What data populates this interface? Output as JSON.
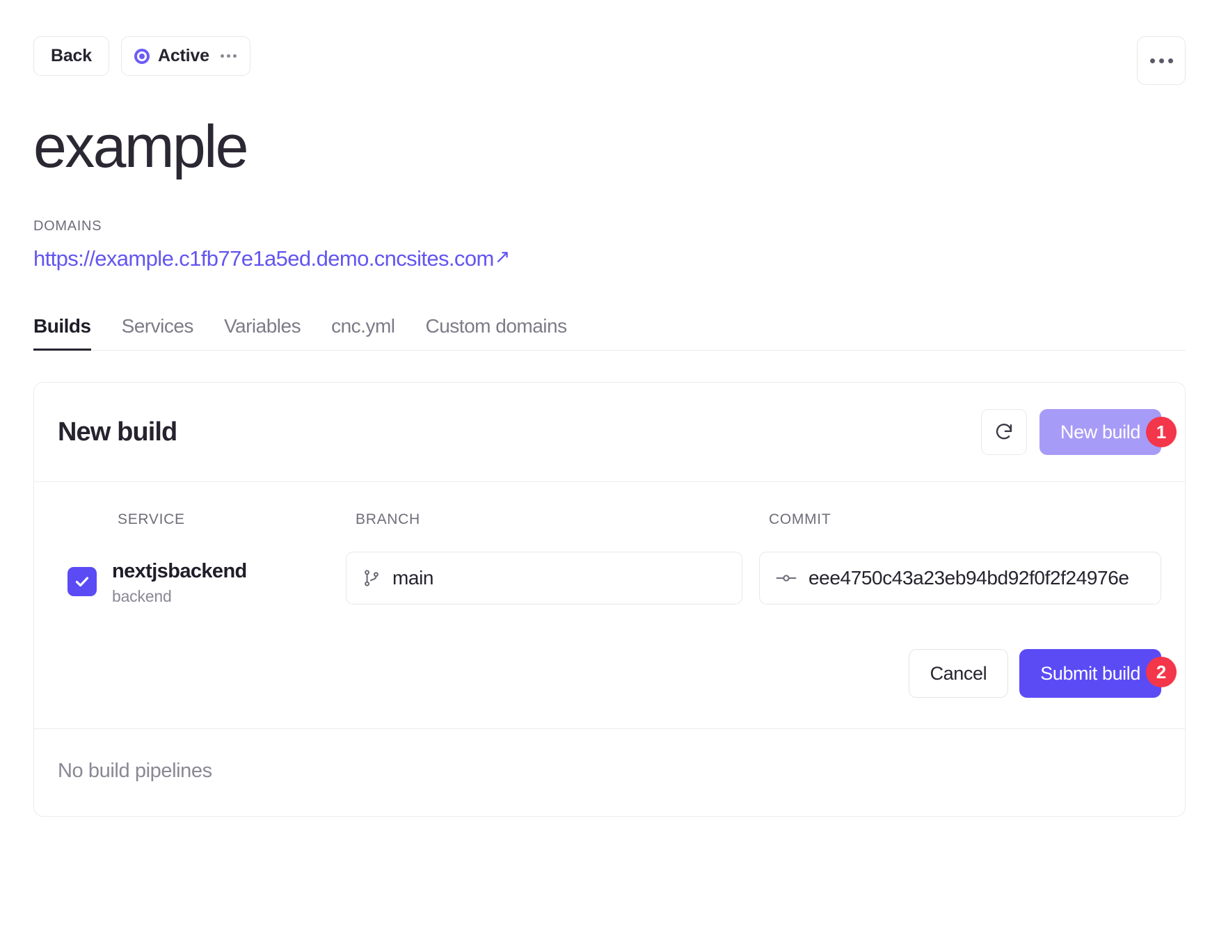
{
  "topbar": {
    "back_label": "Back",
    "status_label": "Active",
    "status_menu_icon": "ellipsis-icon",
    "overflow_menu_icon": "ellipsis-icon"
  },
  "header": {
    "title": "example",
    "domains_label": "DOMAINS",
    "domain_url": "https://example.c1fb77e1a5ed.demo.cncsites.com",
    "external_link_glyph": "↗"
  },
  "tabs": [
    {
      "label": "Builds",
      "active": true
    },
    {
      "label": "Services",
      "active": false
    },
    {
      "label": "Variables",
      "active": false
    },
    {
      "label": "cnc.yml",
      "active": false
    },
    {
      "label": "Custom domains",
      "active": false
    }
  ],
  "card": {
    "title": "New build",
    "refresh_icon": "refresh-icon",
    "new_build_label": "New build",
    "new_build_badge": "1",
    "columns": {
      "service": "SERVICE",
      "branch": "BRANCH",
      "commit": "COMMIT"
    },
    "row": {
      "checked": true,
      "service_name": "nextjsbackend",
      "service_type": "backend",
      "branch_icon": "git-branch-icon",
      "branch_value": "main",
      "commit_icon": "git-commit-icon",
      "commit_value": "eee4750c43a23eb94bd92f0f2f24976e"
    },
    "cancel_label": "Cancel",
    "submit_label": "Submit build",
    "submit_badge": "2",
    "empty_state": "No build pipelines"
  },
  "colors": {
    "accent": "#5b4bf5",
    "accent_muted": "#a79bf8",
    "link": "#6255f0",
    "badge": "#f3364a",
    "text": "#26232e",
    "muted_text": "#8a8893",
    "border": "#e8e8ec"
  }
}
